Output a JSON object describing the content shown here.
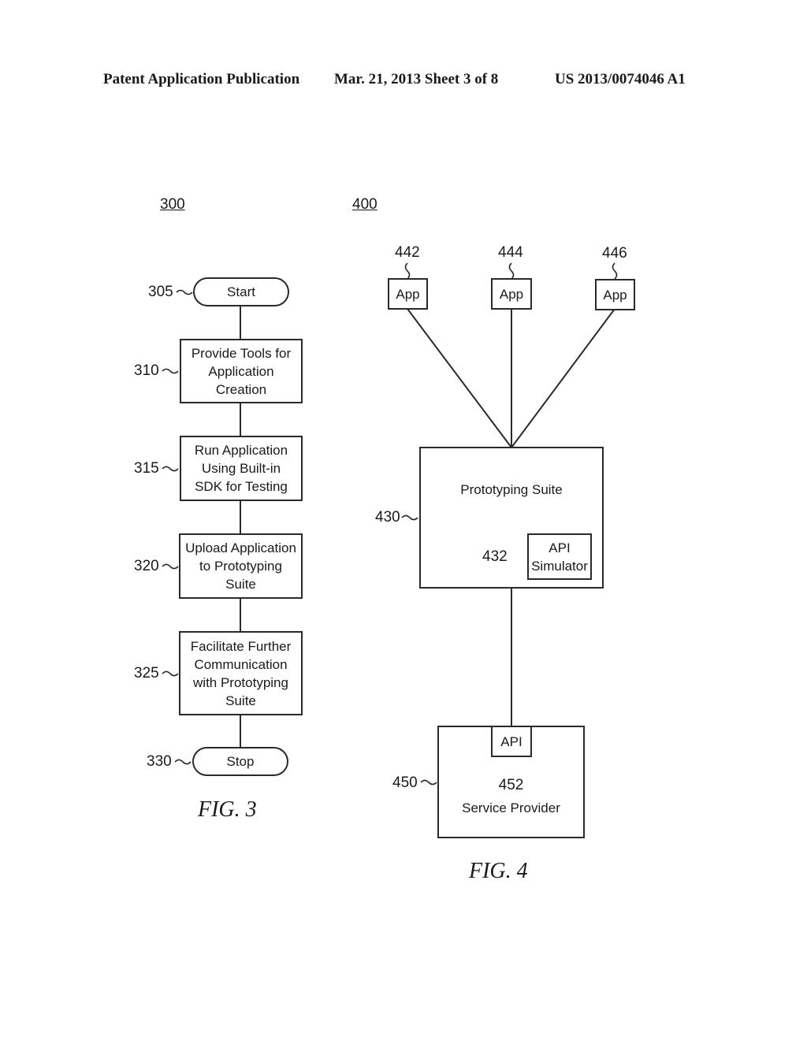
{
  "header": {
    "left": "Patent Application Publication",
    "center": "Mar. 21, 2013  Sheet 3 of 8",
    "right": "US 2013/0074046 A1"
  },
  "fig3": {
    "ref": "300",
    "caption": "FIG.  3",
    "steps": [
      {
        "ref": "305",
        "label": "Start",
        "shape": "terminal"
      },
      {
        "ref": "310",
        "label": "Provide Tools for Application Creation",
        "shape": "process"
      },
      {
        "ref": "315",
        "label": "Run Application Using Built-in SDK for Testing",
        "shape": "process"
      },
      {
        "ref": "320",
        "label": "Upload Application to Prototyping Suite",
        "shape": "process"
      },
      {
        "ref": "325",
        "label": "Facilitate Further Communication with Prototyping Suite",
        "shape": "process"
      },
      {
        "ref": "330",
        "label": "Stop",
        "shape": "terminal"
      }
    ]
  },
  "fig4": {
    "ref": "400",
    "caption": "FIG.  4",
    "apps": [
      {
        "ref": "442",
        "label": "App"
      },
      {
        "ref": "444",
        "label": "App"
      },
      {
        "ref": "446",
        "label": "App"
      }
    ],
    "suite": {
      "ref": "430",
      "label": "Prototyping Suite"
    },
    "simulator": {
      "ref": "432",
      "label": "API Simulator"
    },
    "provider": {
      "ref": "450",
      "label": "Service Provider"
    },
    "api": {
      "ref": "452",
      "label": "API"
    }
  }
}
